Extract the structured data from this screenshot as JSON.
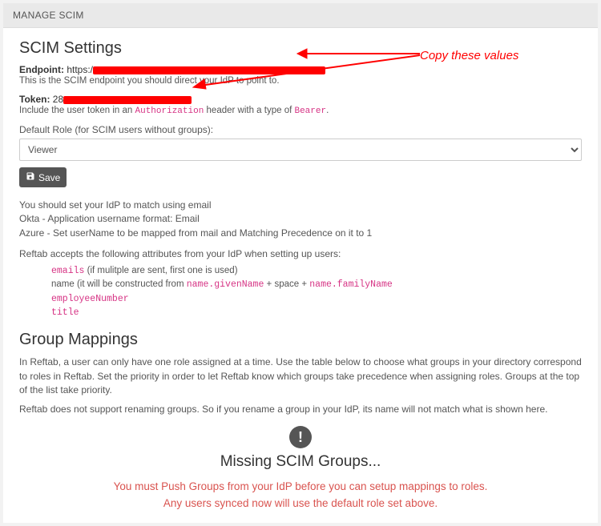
{
  "panel": {
    "title": "MANAGE SCIM"
  },
  "settings": {
    "heading": "SCIM Settings",
    "endpoint_label": "Endpoint:",
    "endpoint_value_prefix": "https:/",
    "endpoint_hint": "This is the SCIM endpoint you should direct your IdP to point to.",
    "token_label": "Token:",
    "token_value_prefix": "28",
    "token_hint_pre": "Include the user token in an ",
    "token_hint_code1": "Authorization",
    "token_hint_mid": " header with a type of ",
    "token_hint_code2": "Bearer",
    "role_label": "Default Role (for SCIM users without groups):",
    "role_value": "Viewer",
    "save_label": "Save"
  },
  "info": {
    "line1": "You should set your IdP to match using email",
    "line2": "Okta - Application username format: Email",
    "line3": "Azure - Set userName to be mapped from mail and Matching Precedence on it to 1",
    "attrs_intro": "Reftab accepts the following attributes from your IdP when setting up users:",
    "attr1_code": "emails",
    "attr1_rest": " (if mulitple are sent, first one is used)",
    "attr2_pre": "name (it will be constructed from ",
    "attr2_c1": "name.givenName",
    "attr2_mid": " + space + ",
    "attr2_c2": "name.familyName",
    "attr3": "employeeNumber",
    "attr4": "title"
  },
  "groups": {
    "heading": "Group Mappings",
    "desc": "In Reftab, a user can only have one role assigned at a time. Use the table below to choose what groups in your directory correspond to roles in Reftab. Set the priority in order to let Reftab know which groups take precedence when assigning roles. Groups at the top of the list take priority.",
    "rename_note": "Reftab does not support renaming groups. So if you rename a group in your IdP, its name will not match what is shown here.",
    "missing_title": "Missing SCIM Groups...",
    "red_line1": "You must Push Groups from your IdP before you can setup mappings to roles.",
    "red_line2": "Any users synced now will use the default role set above."
  },
  "annotation": {
    "text": "Copy these values"
  }
}
